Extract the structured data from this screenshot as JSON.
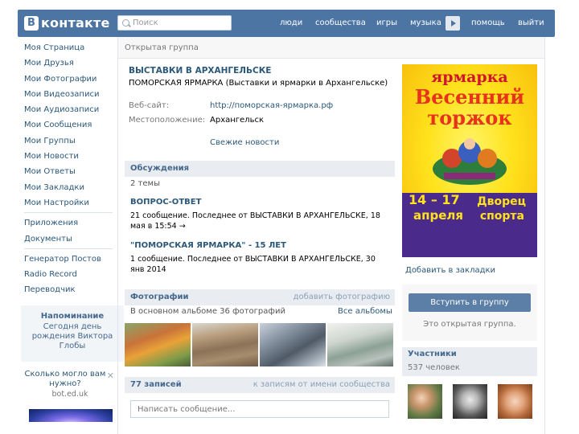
{
  "header": {
    "logo_letter": "В",
    "logo_text": "контакте",
    "search_placeholder": "Поиск",
    "nav": [
      "люди",
      "сообщества",
      "игры",
      "музыка",
      "помощь",
      "выйти"
    ]
  },
  "sidebar": {
    "items": [
      "Моя Страница",
      "Мои Друзья",
      "Мои Фотографии",
      "Мои Видеозаписи",
      "Мои Аудиозаписи",
      "Мои Сообщения",
      "Мои Группы",
      "Мои Новости",
      "Мои Ответы",
      "Мои Закладки",
      "Мои Настройки"
    ],
    "items2": [
      "Приложения",
      "Документы"
    ],
    "items3": [
      "Генератор Постов",
      "Radio Record",
      "Переводчик"
    ],
    "reminder": {
      "title": "Напоминание",
      "text": "Сегодня день рождения Виктора Глобы"
    },
    "ad": {
      "title": "Сколько могло вам нужно?",
      "domain": "bot.ed.uk"
    }
  },
  "group": {
    "page_type": "Открытая группа",
    "title": "ВЫСТАВКИ В АРХАНГЕЛЬСКЕ",
    "status": "ПОМОРСКАЯ ЯРМАРКА (Выставки и ярмарки в Архангельске)",
    "website_label": "Веб-сайт:",
    "website": "http://поморская-ярмарка.рф",
    "location_label": "Местоположение:",
    "location": "Архангельск",
    "fresh_news": "Свежие новости"
  },
  "discussions": {
    "title": "Обсуждения",
    "count": "2 темы",
    "topics": [
      {
        "title": "ВОПРОС-ОТВЕТ",
        "meta": "21 сообщение. Последнее от ВЫСТАВКИ В АРХАНГЕЛЬСКЕ, 18 мая в 15:54 →"
      },
      {
        "title": "\"ПОМОРСКАЯ ЯРМАРКА\" - 15 ЛЕТ",
        "meta": "1 сообщение. Последнее от ВЫСТАВКИ В АРХАНГЕЛЬСКЕ, 30 янв 2014"
      }
    ]
  },
  "photos": {
    "title": "Фотографии",
    "add_link": "добавить фотографию",
    "album_text": "В основном альбоме 36 фотографий",
    "all_albums": "Все альбомы"
  },
  "wall": {
    "count": "77 записей",
    "link": "к записям от имени сообщества",
    "placeholder": "Написать сообщение..."
  },
  "poster": {
    "top": "ярмарка",
    "main1": "Весенний",
    "main2": "торжок",
    "dates1": "14 – 17",
    "dates2": "апреля",
    "venue1": "Дворец",
    "venue2": "спорта"
  },
  "right": {
    "bookmark": "Добавить в закладки",
    "join_button": "Вступить в группу",
    "join_note": "Это открытая группа.",
    "members_title": "Участники",
    "members_count": "537 человек"
  }
}
